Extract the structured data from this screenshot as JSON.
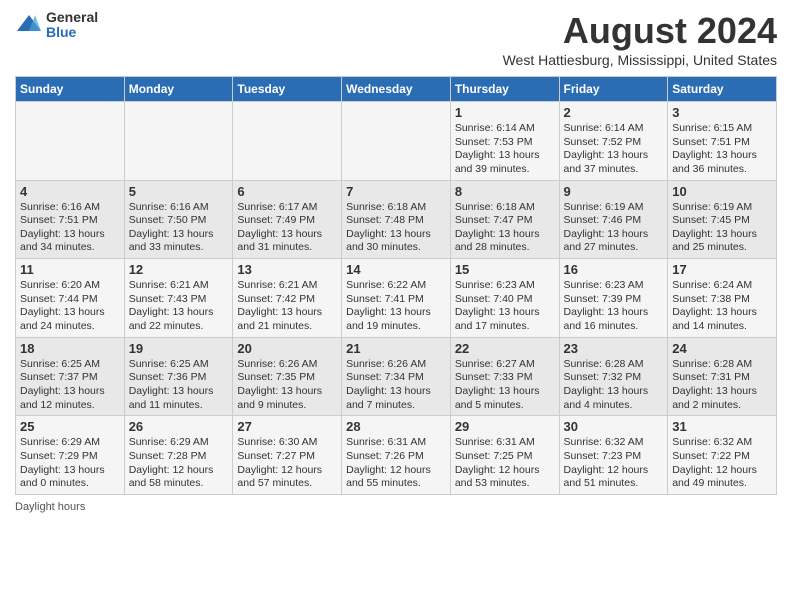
{
  "header": {
    "logo_general": "General",
    "logo_blue": "Blue",
    "month_title": "August 2024",
    "location": "West Hattiesburg, Mississippi, United States"
  },
  "days_of_week": [
    "Sunday",
    "Monday",
    "Tuesday",
    "Wednesday",
    "Thursday",
    "Friday",
    "Saturday"
  ],
  "footer_label": "Daylight hours",
  "weeks": [
    [
      {
        "day": "",
        "info": ""
      },
      {
        "day": "",
        "info": ""
      },
      {
        "day": "",
        "info": ""
      },
      {
        "day": "",
        "info": ""
      },
      {
        "day": "1",
        "info": "Sunrise: 6:14 AM\nSunset: 7:53 PM\nDaylight: 13 hours and 39 minutes."
      },
      {
        "day": "2",
        "info": "Sunrise: 6:14 AM\nSunset: 7:52 PM\nDaylight: 13 hours and 37 minutes."
      },
      {
        "day": "3",
        "info": "Sunrise: 6:15 AM\nSunset: 7:51 PM\nDaylight: 13 hours and 36 minutes."
      }
    ],
    [
      {
        "day": "4",
        "info": "Sunrise: 6:16 AM\nSunset: 7:51 PM\nDaylight: 13 hours and 34 minutes."
      },
      {
        "day": "5",
        "info": "Sunrise: 6:16 AM\nSunset: 7:50 PM\nDaylight: 13 hours and 33 minutes."
      },
      {
        "day": "6",
        "info": "Sunrise: 6:17 AM\nSunset: 7:49 PM\nDaylight: 13 hours and 31 minutes."
      },
      {
        "day": "7",
        "info": "Sunrise: 6:18 AM\nSunset: 7:48 PM\nDaylight: 13 hours and 30 minutes."
      },
      {
        "day": "8",
        "info": "Sunrise: 6:18 AM\nSunset: 7:47 PM\nDaylight: 13 hours and 28 minutes."
      },
      {
        "day": "9",
        "info": "Sunrise: 6:19 AM\nSunset: 7:46 PM\nDaylight: 13 hours and 27 minutes."
      },
      {
        "day": "10",
        "info": "Sunrise: 6:19 AM\nSunset: 7:45 PM\nDaylight: 13 hours and 25 minutes."
      }
    ],
    [
      {
        "day": "11",
        "info": "Sunrise: 6:20 AM\nSunset: 7:44 PM\nDaylight: 13 hours and 24 minutes."
      },
      {
        "day": "12",
        "info": "Sunrise: 6:21 AM\nSunset: 7:43 PM\nDaylight: 13 hours and 22 minutes."
      },
      {
        "day": "13",
        "info": "Sunrise: 6:21 AM\nSunset: 7:42 PM\nDaylight: 13 hours and 21 minutes."
      },
      {
        "day": "14",
        "info": "Sunrise: 6:22 AM\nSunset: 7:41 PM\nDaylight: 13 hours and 19 minutes."
      },
      {
        "day": "15",
        "info": "Sunrise: 6:23 AM\nSunset: 7:40 PM\nDaylight: 13 hours and 17 minutes."
      },
      {
        "day": "16",
        "info": "Sunrise: 6:23 AM\nSunset: 7:39 PM\nDaylight: 13 hours and 16 minutes."
      },
      {
        "day": "17",
        "info": "Sunrise: 6:24 AM\nSunset: 7:38 PM\nDaylight: 13 hours and 14 minutes."
      }
    ],
    [
      {
        "day": "18",
        "info": "Sunrise: 6:25 AM\nSunset: 7:37 PM\nDaylight: 13 hours and 12 minutes."
      },
      {
        "day": "19",
        "info": "Sunrise: 6:25 AM\nSunset: 7:36 PM\nDaylight: 13 hours and 11 minutes."
      },
      {
        "day": "20",
        "info": "Sunrise: 6:26 AM\nSunset: 7:35 PM\nDaylight: 13 hours and 9 minutes."
      },
      {
        "day": "21",
        "info": "Sunrise: 6:26 AM\nSunset: 7:34 PM\nDaylight: 13 hours and 7 minutes."
      },
      {
        "day": "22",
        "info": "Sunrise: 6:27 AM\nSunset: 7:33 PM\nDaylight: 13 hours and 5 minutes."
      },
      {
        "day": "23",
        "info": "Sunrise: 6:28 AM\nSunset: 7:32 PM\nDaylight: 13 hours and 4 minutes."
      },
      {
        "day": "24",
        "info": "Sunrise: 6:28 AM\nSunset: 7:31 PM\nDaylight: 13 hours and 2 minutes."
      }
    ],
    [
      {
        "day": "25",
        "info": "Sunrise: 6:29 AM\nSunset: 7:29 PM\nDaylight: 13 hours and 0 minutes."
      },
      {
        "day": "26",
        "info": "Sunrise: 6:29 AM\nSunset: 7:28 PM\nDaylight: 12 hours and 58 minutes."
      },
      {
        "day": "27",
        "info": "Sunrise: 6:30 AM\nSunset: 7:27 PM\nDaylight: 12 hours and 57 minutes."
      },
      {
        "day": "28",
        "info": "Sunrise: 6:31 AM\nSunset: 7:26 PM\nDaylight: 12 hours and 55 minutes."
      },
      {
        "day": "29",
        "info": "Sunrise: 6:31 AM\nSunset: 7:25 PM\nDaylight: 12 hours and 53 minutes."
      },
      {
        "day": "30",
        "info": "Sunrise: 6:32 AM\nSunset: 7:23 PM\nDaylight: 12 hours and 51 minutes."
      },
      {
        "day": "31",
        "info": "Sunrise: 6:32 AM\nSunset: 7:22 PM\nDaylight: 12 hours and 49 minutes."
      }
    ]
  ]
}
